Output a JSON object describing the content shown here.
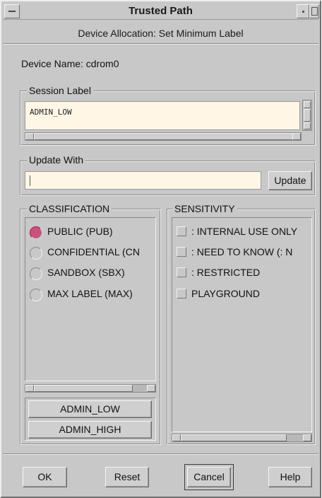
{
  "window": {
    "title": "Trusted Path",
    "subtitle": "Device Allocation: Set Minimum Label"
  },
  "device": {
    "name_label": "Device Name: cdrom0"
  },
  "session_label": {
    "title": "Session Label",
    "value": "ADMIN_LOW"
  },
  "update_with": {
    "title": "Update With",
    "value": "",
    "button": "Update"
  },
  "classification": {
    "title": "CLASSIFICATION",
    "items": [
      {
        "label": "PUBLIC (PUB)",
        "selected": true
      },
      {
        "label": "CONFIDENTIAL (CN",
        "selected": false
      },
      {
        "label": "SANDBOX (SBX)",
        "selected": false
      },
      {
        "label": "MAX LABEL (MAX)",
        "selected": false
      }
    ],
    "admin_low_button": "ADMIN_LOW",
    "admin_high_button": "ADMIN_HIGH"
  },
  "sensitivity": {
    "title": "SENSITIVITY",
    "items": [
      {
        "label": ": INTERNAL USE ONLY"
      },
      {
        "label": ": NEED TO KNOW (: N"
      },
      {
        "label": ": RESTRICTED"
      },
      {
        "label": "PLAYGROUND"
      }
    ]
  },
  "footer": {
    "ok": "OK",
    "reset": "Reset",
    "cancel": "Cancel",
    "help": "Help"
  },
  "colors": {
    "window_bg": "#c8c8c8",
    "text_field_bg": "#fff6e6",
    "selected_radio": "#c8537f"
  }
}
